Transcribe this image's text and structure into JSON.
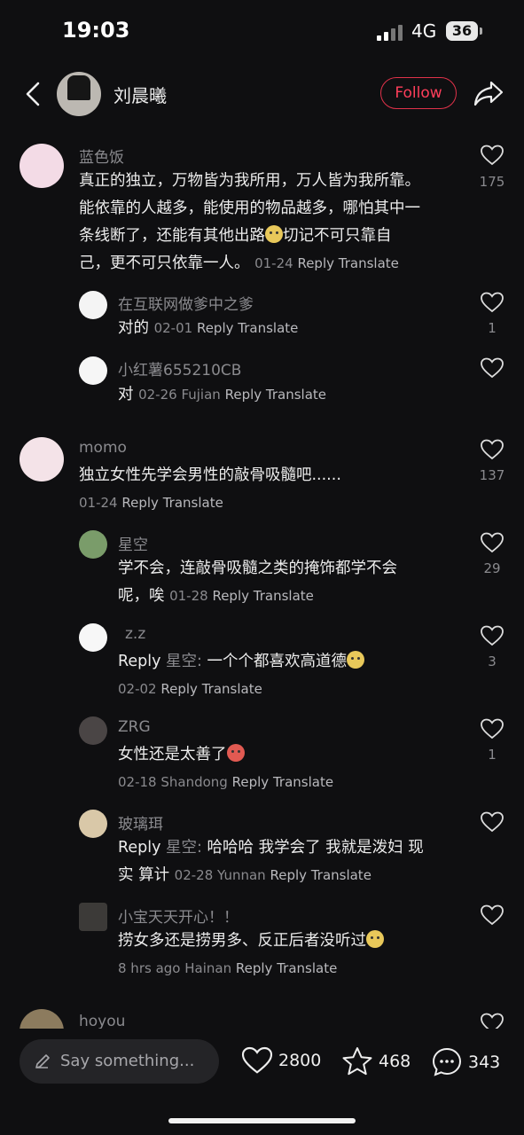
{
  "status": {
    "time": "19:03",
    "network": "4G",
    "battery": "36"
  },
  "header": {
    "username": "刘晨曦",
    "follow_label": "Follow"
  },
  "labels": {
    "reply": "Reply",
    "translate": "Translate"
  },
  "comments": [
    {
      "author": "蓝色饭",
      "text_lines": [
        "真正的独立，万物皆为我所用，万人皆为我所靠。",
        "能依靠的人越多，能使用的物品越多，哪怕其中一",
        "条线断了，还能有其他出路",
        "切记不可只靠自",
        "己，更不可只依靠一人。"
      ],
      "date": "01-24",
      "likes": "175"
    },
    {
      "author": "在互联网做爹中之爹",
      "text": "对的",
      "date": "02-01",
      "likes": "1"
    },
    {
      "author": "小红薯655210CB",
      "text": "对",
      "date": "02-26",
      "location": "Fujian"
    },
    {
      "author": "momo",
      "text": "独立女性先学会男性的敲骨吸髓吧......",
      "date": "01-24",
      "likes": "137"
    },
    {
      "author": "星空",
      "text_line1": "学不会，连敲骨吸髓之类的掩饰都学不会",
      "text_line2": "呢，唉",
      "date": "01-28",
      "likes": "29"
    },
    {
      "author": "z.z",
      "reply_to": "星空",
      "text": "一个个都喜欢高道德",
      "date": "02-02",
      "likes": "3"
    },
    {
      "author": "ZRG",
      "text": "女性还是太善了",
      "date": "02-18",
      "location": "Shandong",
      "likes": "1"
    },
    {
      "author": "玻璃珥",
      "reply_to": "星空",
      "text_line1": "哈哈哈 我学会了 我就是泼妇 现",
      "text_line2": "实 算计",
      "date": "02-28",
      "location": "Yunnan"
    },
    {
      "author": "小宝天天开心！！",
      "text": "捞女多还是捞男多、反正后者没听过",
      "date": "8 hrs ago",
      "location": "Hainan"
    },
    {
      "author": "hoyou"
    }
  ],
  "bottom": {
    "placeholder": "Say something...",
    "likes": "2800",
    "stars": "468",
    "comments": "343"
  },
  "colors": {
    "accent": "#ff3e5a",
    "background": "#0f0f11",
    "muted_text": "#8a8a8e"
  }
}
